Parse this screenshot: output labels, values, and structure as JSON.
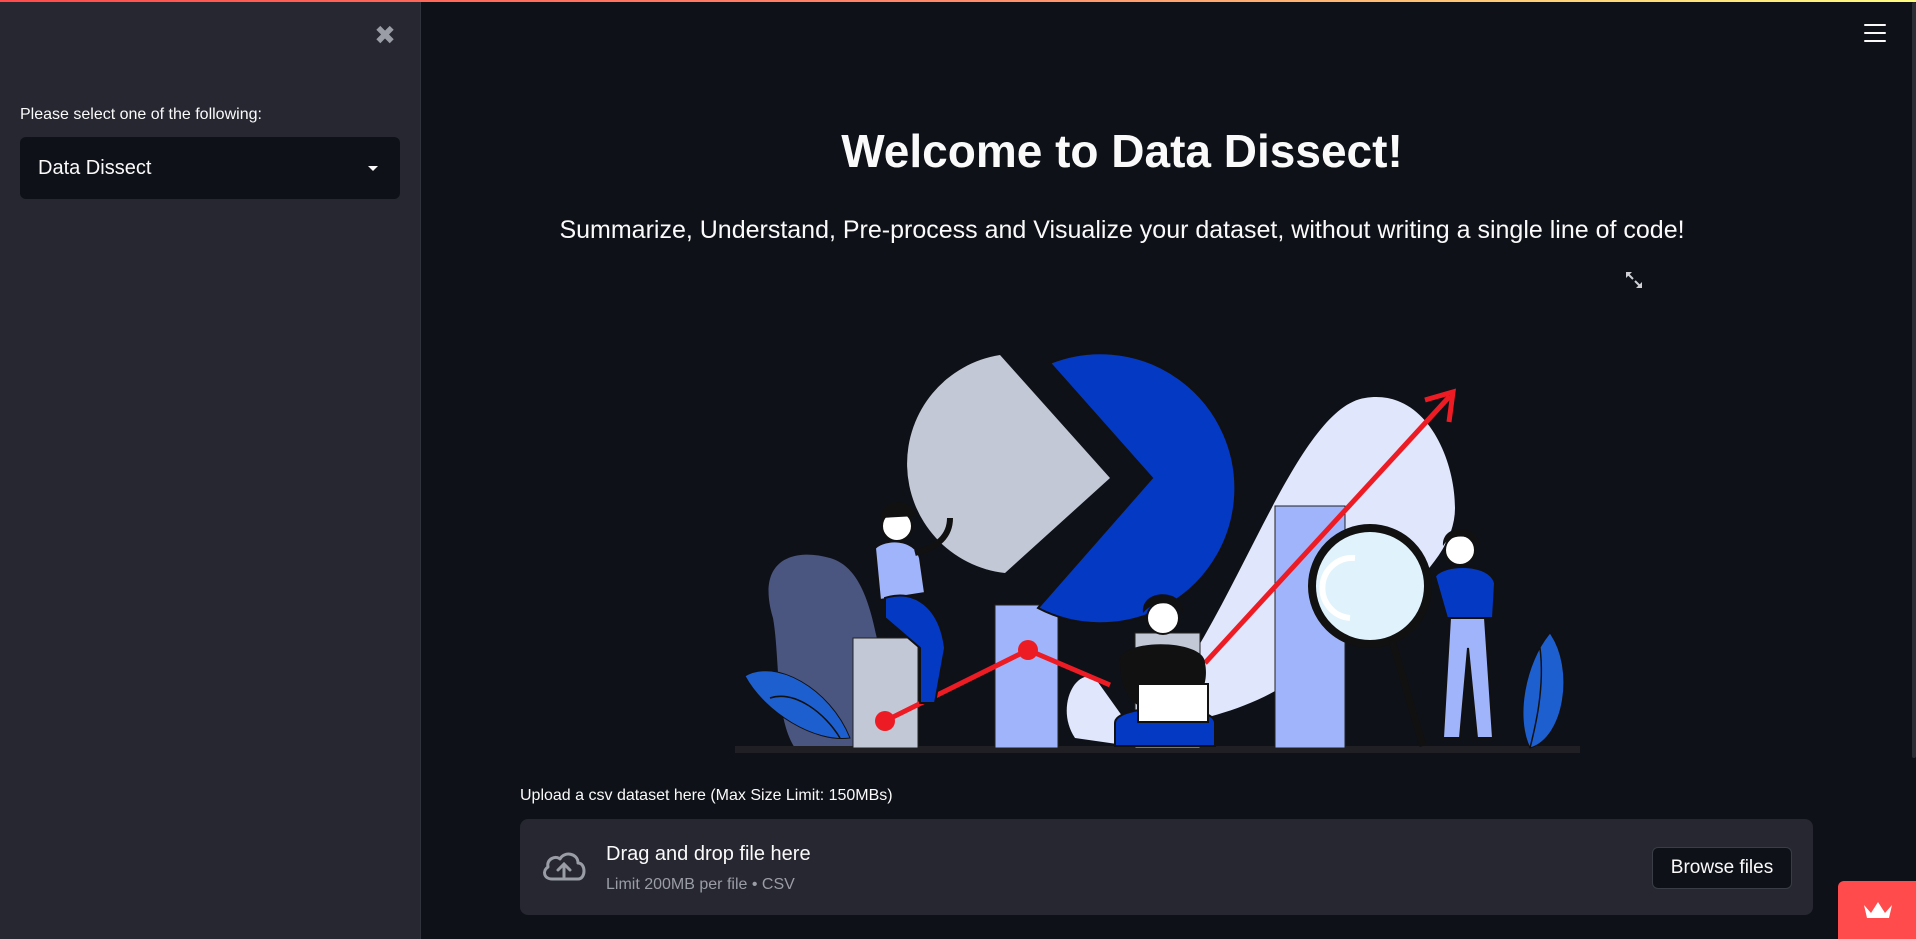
{
  "sidebar": {
    "close_icon": "close-icon",
    "select_label": "Please select one of the following:",
    "select_value": "Data Dissect"
  },
  "header": {
    "menu_icon": "hamburger-menu-icon"
  },
  "main": {
    "title": "Welcome to Data Dissect!",
    "subtitle": "Summarize, Understand, Pre-process and Visualize your dataset, without writing a single line of code!",
    "upload_label": "Upload a csv dataset here (Max Size Limit: 150MBs)",
    "dropzone": {
      "title": "Drag and drop file here",
      "subtitle": "Limit 200MB per file • CSV",
      "button": "Browse files"
    }
  },
  "colors": {
    "background": "#0e1117",
    "sidebar": "#262730",
    "accent": "#ff4b4b",
    "illustration_blue": "#0439c4",
    "illustration_light_blue": "#a0b4fb",
    "illustration_red": "#ed1c24"
  }
}
